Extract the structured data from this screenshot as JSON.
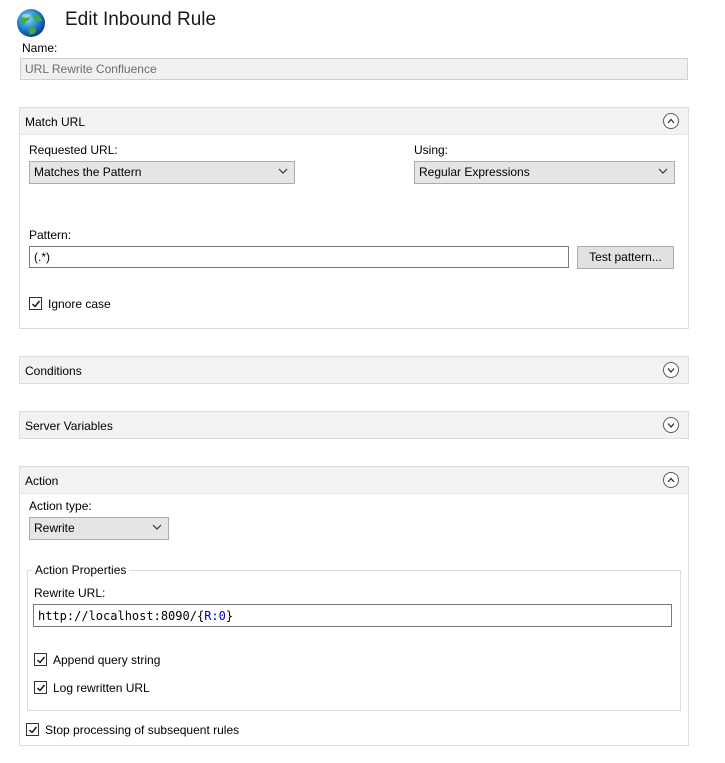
{
  "header": {
    "title": "Edit Inbound Rule",
    "icon": "globe-icon"
  },
  "name_field": {
    "label": "Name:",
    "value": "URL Rewrite Confluence"
  },
  "match_url": {
    "title": "Match URL",
    "requested_url_label": "Requested URL:",
    "requested_url_value": "Matches the Pattern",
    "using_label": "Using:",
    "using_value": "Regular Expressions",
    "pattern_label": "Pattern:",
    "pattern_value": "(.*)",
    "test_pattern_button": "Test pattern...",
    "ignore_case_label": "Ignore case",
    "ignore_case_checked": true
  },
  "conditions": {
    "title": "Conditions"
  },
  "server_variables": {
    "title": "Server Variables"
  },
  "action": {
    "title": "Action",
    "action_type_label": "Action type:",
    "action_type_value": "Rewrite",
    "properties_legend": "Action Properties",
    "rewrite_url_label": "Rewrite URL:",
    "rewrite_url_prefix": "http://localhost:8090/",
    "rewrite_url_brace_open": "{",
    "rewrite_url_token": "R:0",
    "rewrite_url_brace_close": "}",
    "append_query_label": "Append query string",
    "append_query_checked": true,
    "log_rewritten_label": "Log rewritten URL",
    "log_rewritten_checked": true,
    "stop_processing_label": "Stop processing of subsequent rules",
    "stop_processing_checked": true
  },
  "colors": {
    "token_blue": "#0000cc",
    "panel_header": "#f2f2f2"
  }
}
